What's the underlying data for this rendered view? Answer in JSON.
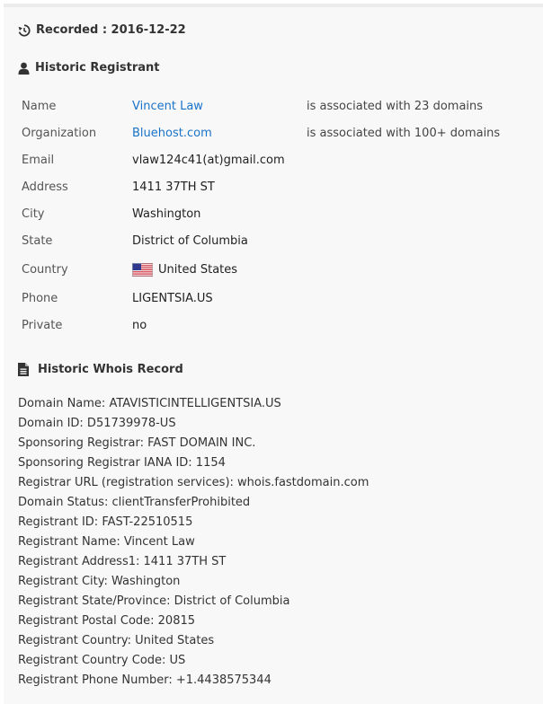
{
  "recorded": "Recorded : 2016-12-22",
  "registrant_section": {
    "title": "Historic Registrant",
    "rows": [
      {
        "label": "Name",
        "value": "Vincent Law",
        "note": "is associated with 23 domains"
      },
      {
        "label": "Organization",
        "value": "Bluehost.com",
        "note": "is associated with 100+ domains"
      },
      {
        "label": "Email",
        "value": "vlaw124c41(at)gmail.com",
        "note": ""
      },
      {
        "label": "Address",
        "value": "1411 37TH ST",
        "note": ""
      },
      {
        "label": "City",
        "value": "Washington",
        "note": ""
      },
      {
        "label": "State",
        "value": "District of Columbia",
        "note": ""
      },
      {
        "label": "Country",
        "value": "United States",
        "note": ""
      },
      {
        "label": "Phone",
        "value": "LIGENTSIA.US",
        "note": ""
      },
      {
        "label": "Private",
        "value": "no",
        "note": ""
      }
    ]
  },
  "whois_section": {
    "title": "Historic Whois Record",
    "lines": [
      "Domain Name: ATAVISTICINTELLIGENTSIA.US",
      "Domain ID: D51739978-US",
      "Sponsoring Registrar: FAST DOMAIN INC.",
      "Sponsoring Registrar IANA ID: 1154",
      "Registrar URL (registration services): whois.fastdomain.com",
      "Domain Status: clientTransferProhibited",
      "Registrant ID: FAST-22510515",
      "Registrant Name: Vincent Law",
      "Registrant Address1: 1411 37TH ST",
      "Registrant City: Washington",
      "Registrant State/Province: District of Columbia",
      "Registrant Postal Code: 20815",
      "Registrant Country: United States",
      "Registrant Country Code: US",
      "Registrant Phone Number: +1.4438575344"
    ]
  },
  "icons": {
    "recorded": "history-icon",
    "registrant": "user-icon",
    "whois": "file-text-icon",
    "country": "us-flag-icon"
  },
  "colors": {
    "link": "#1a73c8",
    "panel": "#f8f8f8"
  }
}
